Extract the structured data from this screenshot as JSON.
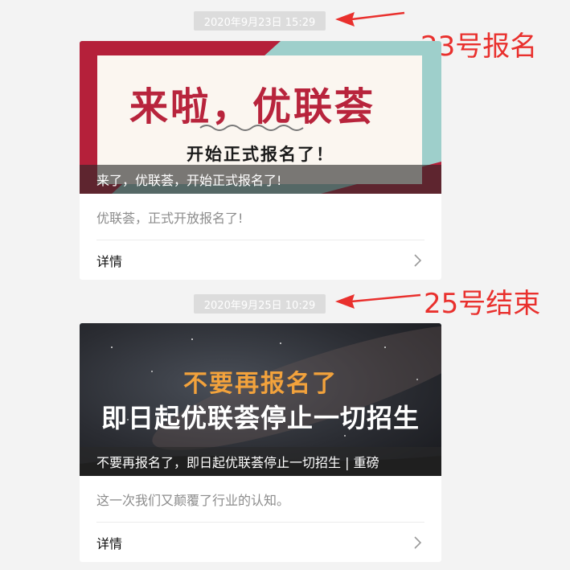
{
  "posts": [
    {
      "timestamp": "2020年9月23日 15:29",
      "cover_title": "来啦，优联荟",
      "cover_subtitle": "开始正式报名了！",
      "cover_caption": "来了，优联荟，开始正式报名了!",
      "summary": "优联荟，正式开放报名了!",
      "detail_label": "详情"
    },
    {
      "timestamp": "2020年9月25日 10:29",
      "cover_title": "不要再报名了",
      "cover_subtitle": "即日起优联荟停止一切招生",
      "cover_caption": "不要再报名了，即日起优联荟停止一切招生 | 重磅",
      "summary": "这一次我们又颠覆了行业的认知。",
      "detail_label": "详情"
    }
  ],
  "annotations": [
    {
      "text": "23号报名"
    },
    {
      "text": "25号结束"
    }
  ],
  "colors": {
    "annotation": "#e9302d",
    "background": "#f3f3f3",
    "timestamp_bg": "#dcdcdc"
  },
  "icons": {
    "detail_arrow": "chevron-right-icon",
    "annotation_arrow": "red-arrow-icon"
  }
}
